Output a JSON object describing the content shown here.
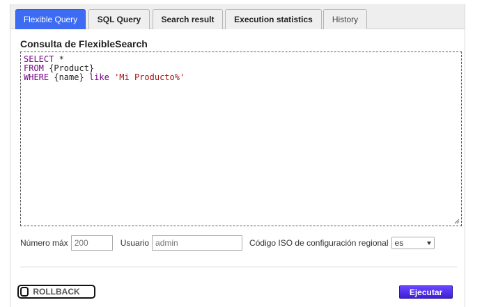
{
  "tabs": [
    {
      "label": "Flexible Query",
      "active": true
    },
    {
      "label": "SQL Query",
      "active": false
    },
    {
      "label": "Search result",
      "active": false
    },
    {
      "label": "Execution statistics",
      "active": false
    },
    {
      "label": "History",
      "active": false
    }
  ],
  "editor": {
    "title": "Consulta de FlexibleSearch",
    "line1_kw": "SELECT",
    "line1_rest": " *",
    "line2_kw": "FROM",
    "line2_rest": " {Product}",
    "line3_kw": "WHERE",
    "line3_mid": " {name} ",
    "line3_kw2": "like",
    "line3_sp": " ",
    "line3_str": "'Mi Producto%'"
  },
  "params": {
    "max_label": "Número máx",
    "max_placeholder": "200",
    "user_label": "Usuario",
    "user_placeholder": "admin",
    "locale_label": "Código ISO de configuración regional",
    "locale_value": "es"
  },
  "actions": {
    "rollback_label": "ROLLBACK",
    "execute_label": "Ejecutar"
  },
  "colors": {
    "active_tab": "#3d6cf2",
    "keyword": "#770088",
    "string": "#aa1111",
    "execute_button": "#4a2ae6"
  }
}
